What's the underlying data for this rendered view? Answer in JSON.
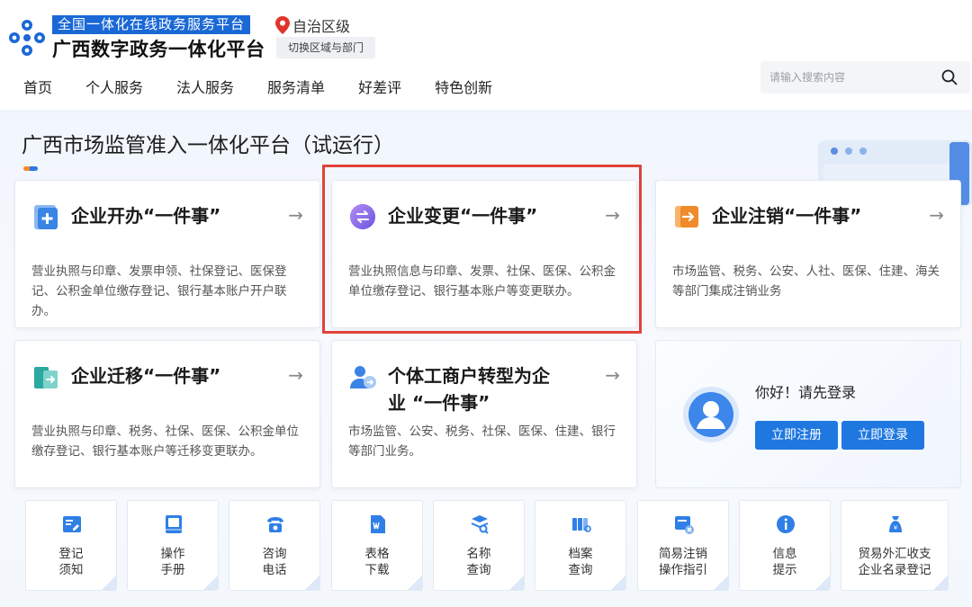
{
  "header": {
    "brand_top": "全国一体化在线政务服务平台",
    "brand_main": "广西数字政务一体化平台",
    "region": "自治区级",
    "switch_region": "切换区域与部门",
    "nav": [
      "首页",
      "个人服务",
      "法人服务",
      "服务清单",
      "好差评",
      "特色创新"
    ],
    "search_placeholder": "请输入搜索内容"
  },
  "main": {
    "page_title": "广西市场监管准入一体化平台（试运行）",
    "cards": [
      {
        "title": "企业开办“一件事”",
        "desc": "营业执照与印章、发票申领、社保登记、医保登记、公积金单位缴存登记、银行基本账户开户联办。",
        "icon": "plus-file-icon"
      },
      {
        "title": "企业变更“一件事”",
        "desc": "营业执照信息与印章、发票、社保、医保、公积金单位缴存登记、银行基本账户等变更联办。",
        "icon": "exchange-icon"
      },
      {
        "title": "企业注销“一件事”",
        "desc": "市场监管、税务、公安、人社、医保、住建、海关等部门集成注销业务",
        "icon": "exit-icon"
      },
      {
        "title": "企业迁移“一件事”",
        "desc": "营业执照与印章、税务、社保、医保、公积金单位缴存登记、银行基本账户等迁移变更联办。",
        "icon": "migrate-icon"
      },
      {
        "title_line1": "个体工商户转型为企",
        "title_line2": "业 “一件事”",
        "desc": "市场监管、公安、税务、社保、医保、住建、银行等部门业务。",
        "icon": "person-transform-icon"
      }
    ],
    "arrow": "→",
    "login": {
      "hello": "你好！请先登录",
      "register": "立即注册",
      "login": "立即登录"
    },
    "tools": [
      {
        "label": "登记\n须知",
        "icon": "notice-icon"
      },
      {
        "label": "操作\n手册",
        "icon": "manual-icon"
      },
      {
        "label": "咨询\n电话",
        "icon": "phone-icon"
      },
      {
        "label": "表格\n下载",
        "icon": "word-doc-icon"
      },
      {
        "label": "名称\n查询",
        "icon": "name-search-icon"
      },
      {
        "label": "档案\n查询",
        "icon": "archive-icon"
      },
      {
        "label": "简易注销\n操作指引",
        "icon": "simple-cancel-icon"
      },
      {
        "label": "信息\n提示",
        "icon": "info-icon"
      },
      {
        "label": "贸易外汇收支\n企业名录登记",
        "icon": "forex-icon"
      }
    ]
  },
  "colors": {
    "primary": "#1f78e0",
    "brand_bar": "#1a68d6",
    "highlight": "#e0433b",
    "accent_orange": "#f28a2e"
  }
}
